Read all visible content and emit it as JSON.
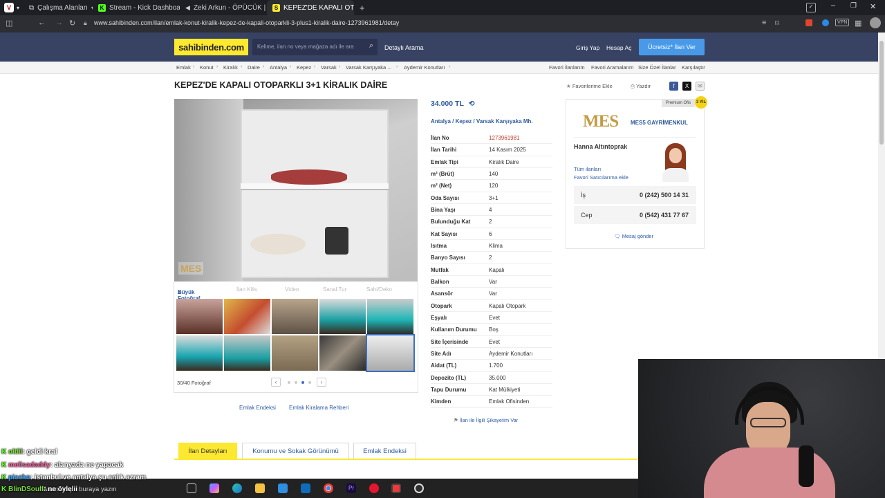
{
  "browser": {
    "tabs": [
      {
        "label": "Çalışma Alanları",
        "icon": "workspaces-icon"
      },
      {
        "label": "Stream - Kick Dashboard",
        "icon": "kick-icon"
      },
      {
        "label": "Zeki Arkun - ÖPÜCÜK | Mu",
        "icon": "speaker-icon"
      },
      {
        "label": "KEPEZ'DE KAPALI OTOPARK",
        "icon": "sahibinden-favicon"
      }
    ],
    "url": "www.sahibinden.com/ilan/emlak-konut-kiralik-kepez-de-kapali-otoparkli-3-plus1-kiralik-daire-1273961981/detay",
    "vpn_label": "VPN"
  },
  "header": {
    "logo": "sahibinden.com",
    "search_placeholder": "Kelime, ilan no veya mağaza adı ile ara",
    "detailed_search": "Detaylı Arama",
    "login": "Giriş Yap",
    "register": "Hesap Aç",
    "post_ad": "Ücretsiz* İlan Ver"
  },
  "breadcrumb": [
    "Emlak",
    "Konut",
    "Kiralık",
    "Daire",
    "Antalya",
    "Kepez",
    "Varsak",
    "Varsak Karşıyaka ...",
    "Aydemir Konutları"
  ],
  "breadcrumb_right": [
    "Favori İlanlarım",
    "Favori Aramalarım",
    "Size Özel İlanlar",
    "Karşılaştır"
  ],
  "listing": {
    "title": "KEPEZ'DE KAPALI OTOPARKLI 3+1 KİRALIK DAİRE",
    "add_favorite": "Favorilerime Ekle",
    "print": "Yazdır",
    "price": "34.000 TL",
    "location": [
      "Antalya",
      "Kepez",
      "Varsak Karşıyaka Mh."
    ],
    "specs": [
      {
        "k": "İlan No",
        "v": "1273961981"
      },
      {
        "k": "İlan Tarihi",
        "v": "14 Kasım 2025"
      },
      {
        "k": "Emlak Tipi",
        "v": "Kiralık Daire"
      },
      {
        "k": "m² (Brüt)",
        "v": "140"
      },
      {
        "k": "m² (Net)",
        "v": "120"
      },
      {
        "k": "Oda Sayısı",
        "v": "3+1"
      },
      {
        "k": "Bina Yaşı",
        "v": "4"
      },
      {
        "k": "Bulunduğu Kat",
        "v": "2"
      },
      {
        "k": "Kat Sayısı",
        "v": "6"
      },
      {
        "k": "Isıtma",
        "v": "Klima"
      },
      {
        "k": "Banyo Sayısı",
        "v": "2"
      },
      {
        "k": "Mutfak",
        "v": "Kapalı"
      },
      {
        "k": "Balkon",
        "v": "Var"
      },
      {
        "k": "Asansör",
        "v": "Var"
      },
      {
        "k": "Otopark",
        "v": "Kapalı Otopark"
      },
      {
        "k": "Eşyalı",
        "v": "Evet"
      },
      {
        "k": "Kullanım Durumu",
        "v": "Boş"
      },
      {
        "k": "Site İçerisinde",
        "v": "Evet"
      },
      {
        "k": "Site Adı",
        "v": "Aydemir Konutları"
      },
      {
        "k": "Aidat (TL)",
        "v": "1.700"
      },
      {
        "k": "Depozito (TL)",
        "v": "35.000"
      },
      {
        "k": "Tapu Durumu",
        "v": "Kat Mülkiyeti"
      },
      {
        "k": "Kimden",
        "v": "Emlak Ofisinden"
      }
    ],
    "complain": "İlan ile İlgili Şikayetim Var"
  },
  "photos": {
    "big_photo": "Büyük Fotoğraf",
    "map": "İlan Kilis",
    "video": "Video",
    "virtual_tour": "Sanal Tur",
    "sahi": "Sahi/Deko",
    "watermark": "MES",
    "counter": "30/40 Fotoğraf"
  },
  "below_links": [
    "Emlak Endeksi",
    "Emlak Kiralama Rehberi"
  ],
  "seller": {
    "badge": "Premium Ofis",
    "badge_years": "3 YIL",
    "logo": "MES",
    "company": "MES5 GAYRİMENKUL",
    "agent": "Hanna Altıntoprak",
    "all_ads": "Tüm ilanları",
    "fav_seller": "Favori Satıcılarıma ekle",
    "phones": [
      {
        "label": "İş",
        "number": "0 (242) 500 14 31"
      },
      {
        "label": "Cep",
        "number": "0 (542) 431 77 67"
      }
    ],
    "message": "Mesaj gönder"
  },
  "detail_tabs": [
    "İlan Detayları",
    "Konumu ve Sokak Görünümü",
    "Emlak Endeksi"
  ],
  "chat": [
    {
      "user": "oltlil",
      "msg": ": geldi kral"
    },
    {
      "user": "melisadaddy",
      "msg": ": alanyada ne yapacak"
    },
    {
      "user": "piccko",
      "msg": ": istanbul ve antalya şu anlık azram"
    },
    {
      "user": "BlinDSoulf",
      "msg": ": ne öylelii"
    }
  ],
  "taskbar": {
    "search_placeholder": "Aramak için buraya yazın"
  }
}
